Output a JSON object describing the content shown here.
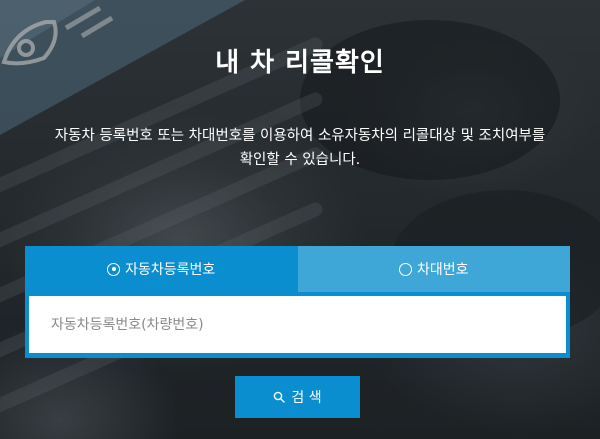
{
  "page": {
    "title": "내 차 리콜확인",
    "description_line1": "자동차 등록번호 또는 차대번호를 이용하여 소유자동차의 리콜대상 및 조치여부를",
    "description_line2": "확인할 수 있습니다."
  },
  "search_type": {
    "tabs": [
      {
        "label": "자동차등록번호",
        "selected": true
      },
      {
        "label": "차대번호",
        "selected": false
      }
    ]
  },
  "search": {
    "placeholder": "자동차등록번호(차량번호)",
    "value": "",
    "button_label": "검 색"
  },
  "colors": {
    "accent": "#0b8ed0",
    "tab_inactive": "#3fa6d8",
    "text_light": "#ffffff"
  }
}
